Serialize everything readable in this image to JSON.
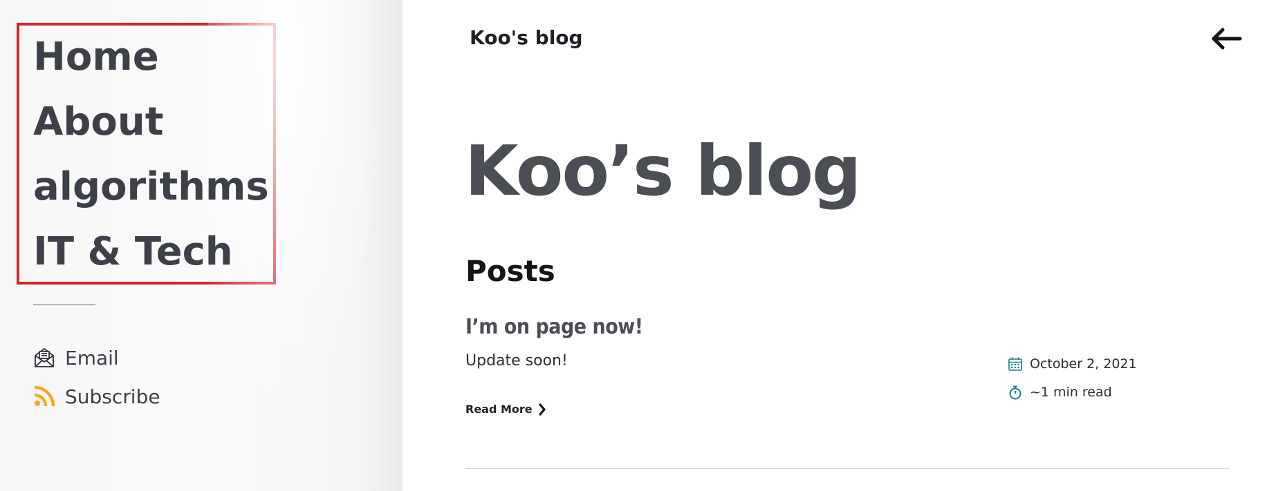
{
  "sidebar": {
    "nav": [
      {
        "label": "Home"
      },
      {
        "label": "About"
      },
      {
        "label": "algorithms"
      },
      {
        "label": "IT & Tech"
      }
    ],
    "contacts": [
      {
        "label": "Email",
        "icon": "envelope-open-icon"
      },
      {
        "label": "Subscribe",
        "icon": "rss-icon"
      }
    ]
  },
  "header": {
    "site_title": "Koo's blog",
    "back_icon": "arrow-left-icon"
  },
  "main": {
    "hero_title": "Koo’s blog",
    "section_title": "Posts",
    "posts": [
      {
        "title": "I’m on page now!",
        "excerpt": "Update soon!",
        "read_more": "Read More",
        "date": "October 2, 2021",
        "read_time": "~1 min read"
      }
    ]
  },
  "colors": {
    "highlight_box": "#d9232e",
    "rss_orange": "#f5a623",
    "meta_icon_teal": "#1f7f86",
    "heading_gray": "#4b4e55"
  }
}
